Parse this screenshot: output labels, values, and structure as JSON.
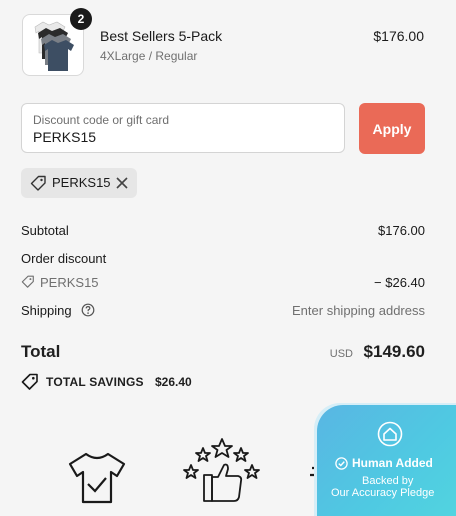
{
  "product": {
    "title": "Best Sellers 5-Pack",
    "variant": "4XLarge / Regular",
    "price": "$176.00",
    "quantity": "2",
    "image_icon": "tshirt-stack-icon"
  },
  "discount": {
    "placeholder": "Discount code or gift card",
    "value": "PERKS15",
    "apply_label": "Apply",
    "apply_color": "#ea6a57",
    "applied_code": "PERKS15"
  },
  "summary": {
    "subtotal_label": "Subtotal",
    "subtotal_value": "$176.00",
    "order_discount_label": "Order discount",
    "discount_code": "PERKS15",
    "discount_value": "− $26.40",
    "shipping_label": "Shipping",
    "shipping_value": "Enter shipping address",
    "total_label": "Total",
    "currency": "USD",
    "total_value": "$149.60",
    "savings_label": "TOTAL SAVINGS",
    "savings_value": "$26.40"
  },
  "pledge": {
    "title": "Human Added",
    "line1": "Backed by",
    "line2": "Our Accuracy Pledge"
  }
}
